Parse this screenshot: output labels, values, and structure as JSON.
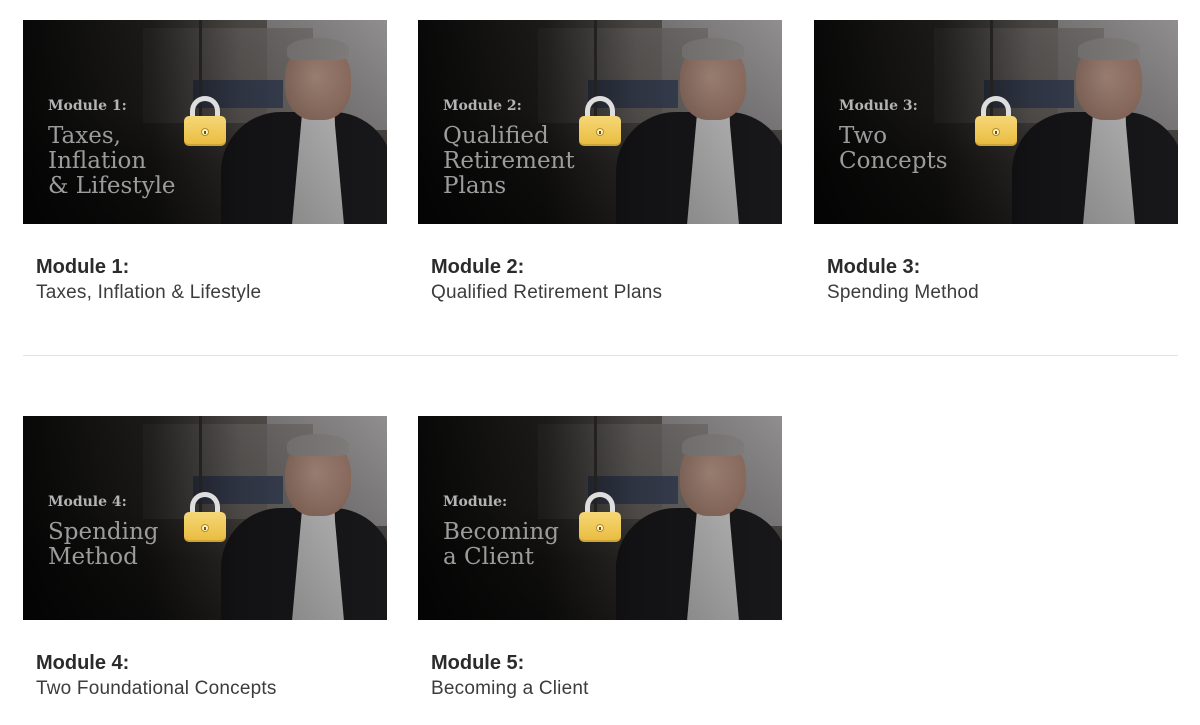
{
  "modules": [
    {
      "thumb_module": "Module 1:",
      "thumb_title": "Taxes,\nInflation\n& Lifestyle",
      "caption_module": "Module 1:",
      "caption_title": "Taxes, Inflation & Lifestyle",
      "locked": true
    },
    {
      "thumb_module": "Module 2:",
      "thumb_title": "Qualified\nRetirement\nPlans",
      "caption_module": "Module 2:",
      "caption_title": "Qualified Retirement Plans",
      "locked": true
    },
    {
      "thumb_module": "Module 3:",
      "thumb_title": "Two\nConcepts",
      "caption_module": "Module 3:",
      "caption_title": "Spending Method",
      "locked": true
    },
    {
      "thumb_module": "Module 4:",
      "thumb_title": "Spending\nMethod",
      "caption_module": "Module 4:",
      "caption_title": "Two Foundational Concepts",
      "locked": true
    },
    {
      "thumb_module": "Module:",
      "thumb_title": "Becoming\na Client",
      "caption_module": "Module 5:",
      "caption_title": "Becoming a Client",
      "locked": true
    }
  ],
  "colors": {
    "lock_gold": "#e9bb3d",
    "caption_text": "#2b2b2b",
    "thumb_text": "#9c9c9c"
  },
  "icons": {
    "lock": "padlock-icon"
  }
}
